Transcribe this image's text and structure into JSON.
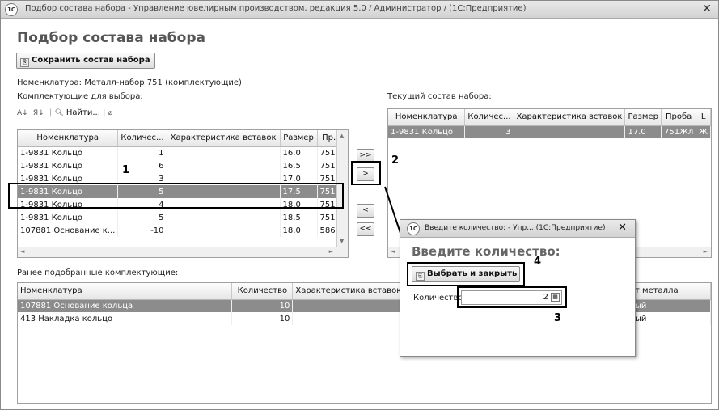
{
  "window": {
    "title": "Подбор состава набора - Управление ювелирным производством, редакция 5.0 / Администратор / (1С:Предприятие)",
    "logo": "1С"
  },
  "page_title": "Подбор состава набора",
  "save_button": "Сохранить состав набора",
  "nomenclature_line": "Номенклатура: Металл-набор 751 (комплектующие)",
  "left_panel": {
    "label": "Комплектующие для выбора:",
    "find_button": "Найти...",
    "columns": [
      "Номенклатура",
      "Количес...",
      "Характеристика вставок",
      "Размер",
      "Пр..."
    ],
    "rows": [
      [
        "1-9831 Кольцо",
        "1",
        "",
        "16.0",
        "751..."
      ],
      [
        "1-9831 Кольцо",
        "6",
        "",
        "16.5",
        "751..."
      ],
      [
        "1-9831 Кольцо",
        "3",
        "",
        "17.0",
        "751..."
      ],
      [
        "1-9831 Кольцо",
        "5",
        "",
        "17.5",
        "751..."
      ],
      [
        "1-9831 Кольцо",
        "4",
        "",
        "18.0",
        "751..."
      ],
      [
        "1-9831 Кольцо",
        "5",
        "",
        "18.5",
        "751..."
      ],
      [
        "107881 Основание к...",
        "-10",
        "",
        "18.0",
        "586..."
      ]
    ],
    "selected_row": 3
  },
  "transfer_buttons": [
    ">>",
    ">",
    "<",
    "<<"
  ],
  "right_panel": {
    "label": "Текущий состав набора:",
    "columns": [
      "Номенклатура",
      "Количес...",
      "Характеристика вставок",
      "Размер",
      "Проба",
      "L"
    ],
    "rows": [
      [
        "1-9831 Кольцо",
        "3",
        "",
        "17.0",
        "751Жл",
        "Ж"
      ]
    ]
  },
  "bottom_panel": {
    "label": "Ранее подобранные комплектующие:",
    "columns": [
      "Номенклатура",
      "Количество",
      "Характеристика вставок",
      "т металла"
    ],
    "rows": [
      [
        "107881 Основание кольца",
        "10",
        "",
        "ый"
      ],
      [
        "413 Накладка кольцо",
        "10",
        "",
        "ый"
      ]
    ]
  },
  "dialog": {
    "title": "Введите количество: - Упр...  (1С:Предприятие)",
    "heading": "Введите количество:",
    "button": "Выбрать и закрыть",
    "field_label": "Количество:",
    "field_value": "2"
  },
  "annotations": [
    "1",
    "2",
    "3",
    "4"
  ]
}
